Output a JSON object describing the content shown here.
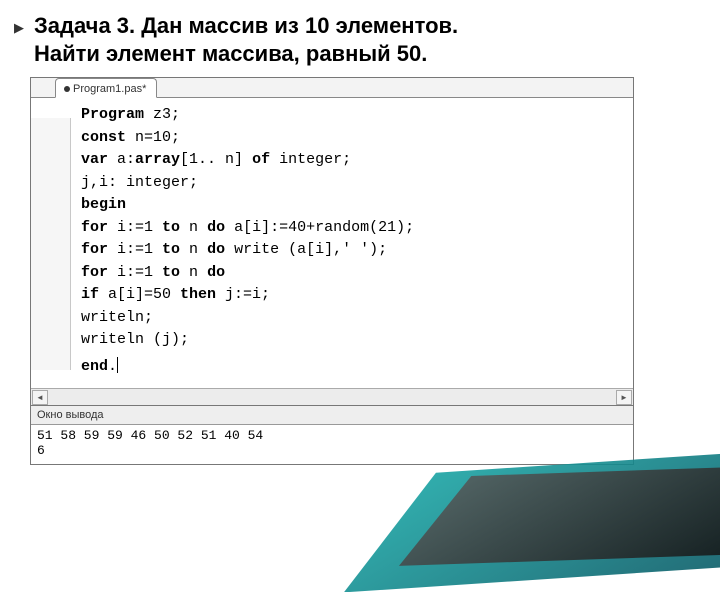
{
  "title_line1": "Задача 3. Дан массив из 10 элементов.",
  "title_line2": "Найти элемент массива, равный 50.",
  "tab_name": "Program1.pas*",
  "code": {
    "l1": {
      "kw": "Program",
      "t": " z3;"
    },
    "l2": {
      "kw": "const",
      "t": " n=10;"
    },
    "l3": {
      "kw1": "var",
      "t1": " a:",
      "kw2": "array",
      "t2": "[1.. n] ",
      "kw3": "of",
      "t3": "   integer;"
    },
    "l4": "    j,i: integer;",
    "l5": {
      "kw": "begin"
    },
    "l6": {
      "p": "  ",
      "kw1": "for",
      "t1": " i:=1 ",
      "kw2": "to",
      "t2": " n ",
      "kw3": "do",
      "t3": " a[i]:=40+random(21);"
    },
    "l7": {
      "p": "  ",
      "kw1": "for",
      "t1": " i:=1 ",
      "kw2": "to",
      "t2": " n ",
      "kw3": "do",
      "t3": " write (a[i],' ');"
    },
    "l8": {
      "p": "  ",
      "kw1": "for",
      "t1": " i:=1 ",
      "kw2": "to",
      "t2": " n ",
      "kw3": "do"
    },
    "l9": {
      "p": "  ",
      "kw1": "if",
      "t1": " a[i]=50 ",
      "kw2": "then",
      "t2": " j:=i;"
    },
    "l10": "  writeln;",
    "l11": "  writeln (j);",
    "l12": {
      "kw": "end",
      "t": "."
    }
  },
  "output_title": "Окно вывода",
  "output_line1": "51 58 59 59 46 50 52 51 40 54",
  "output_line2": "6"
}
